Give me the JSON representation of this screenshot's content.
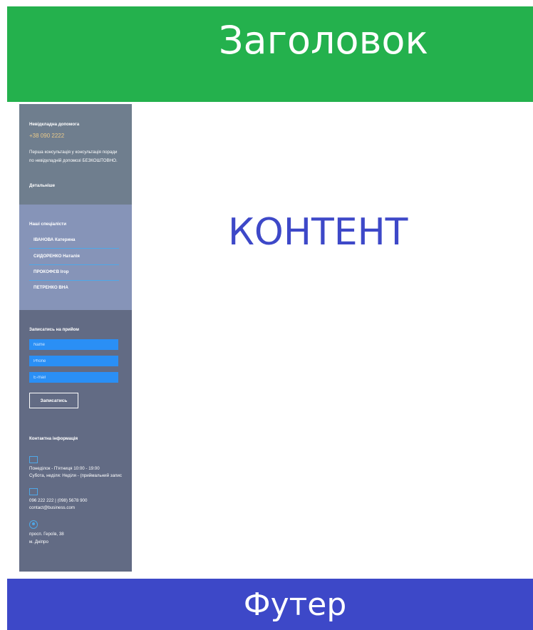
{
  "header": {
    "title": "Заголовок"
  },
  "content": {
    "text": "КОНТЕНТ"
  },
  "footer": {
    "text": "Футер"
  },
  "sidebar": {
    "consult": {
      "title": "Невідкладна допомога",
      "phone": "+38 090 2222",
      "text": "Перша консультація у консультація поради по невідкладній допомозі БЕЗКОШТОВНО.",
      "more": "Детальніше"
    },
    "specialists": {
      "title": "Наші спеціалісти",
      "items": [
        "ІВАНОВА Катерина",
        "СИДОРЕНКО Наталія",
        "ПРОКОФЄВ Ігор",
        "ПЕТРЕНКО ВНА"
      ]
    },
    "form": {
      "title": "Записатись на прийом",
      "name_placeholder": "Name",
      "phone_placeholder": "Phone",
      "email_placeholder": "E-mail",
      "submit_label": "Записатись"
    },
    "contacts": {
      "title": "Контактна інформація",
      "hours_1": "Понеділок - П'ятниця 10:00 - 19:00",
      "hours_2": "Субота, неділя: Неділя - (приймальний запис",
      "phones": "096 222 222 | (098) 5678 900",
      "email": "contact@business.com",
      "address_1": "просп. Героїв, 38",
      "address_2": "м. Дніпро"
    }
  },
  "colors": {
    "header_bg": "#24b14d",
    "footer_bg": "#3d48c8",
    "content_text": "#3d48c8",
    "sidebar_top": "#6f7e8e",
    "sidebar_mid": "#8694b8",
    "sidebar_bottom": "#626b84",
    "field_bg": "#2a8ff5"
  }
}
